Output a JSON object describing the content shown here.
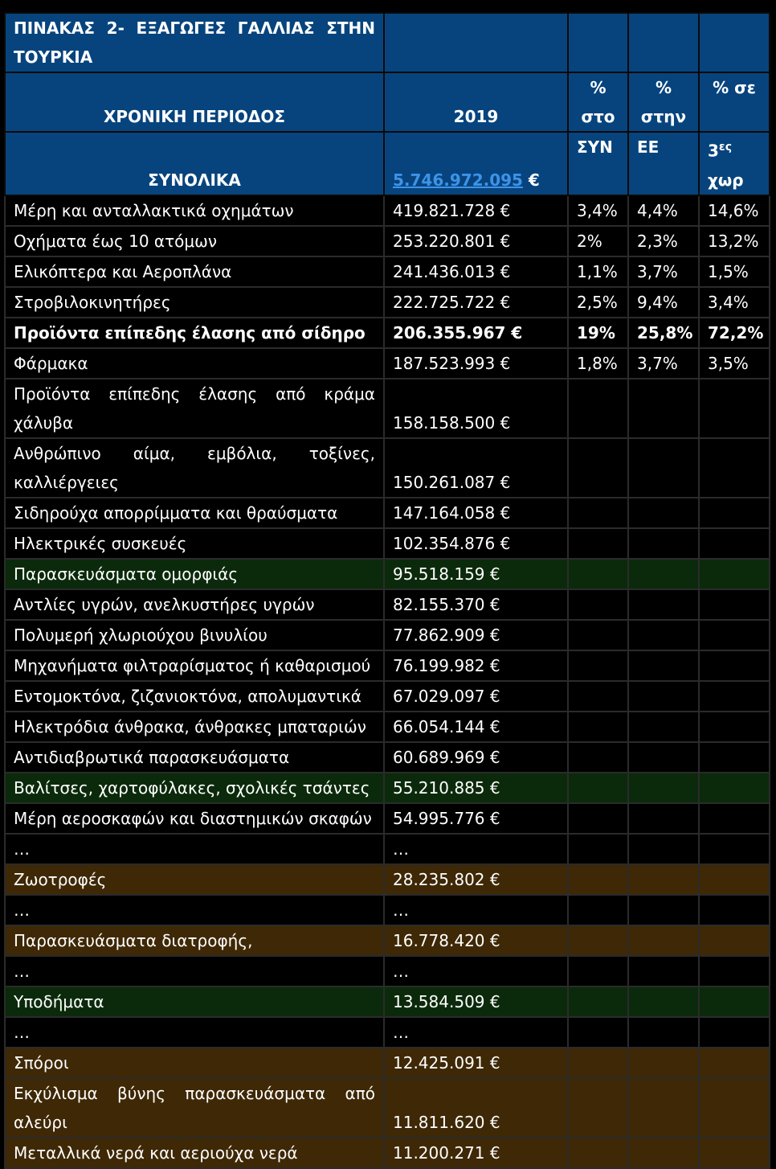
{
  "title": "ΠΙΝΑΚΑΣ 2- ΕΞΑΓΩΓΕΣ ΓΑΛΛΙΑΣ ΣΤΗΝ ΤΟΥΡΚΙΑ",
  "header": {
    "period_label": "ΧΡΟΝΙΚΗ ΠΕΡΙΟΔΟΣ",
    "year": "2019",
    "col_syn_1": "%",
    "col_syn_2": "στο",
    "col_ee_1": "%",
    "col_ee_2": "στην",
    "col_3rd": "% σε",
    "totals_label": "ΣΥΝΟΛΙΚΑ",
    "total_value": "5.746.972.095",
    "total_suffix": "€",
    "syn_cont": "ΣΥΝ",
    "ee_cont": "ΕΕ",
    "third_base": "3",
    "third_sup": "ες",
    "third_cont": "χωρ"
  },
  "rows": [
    {
      "label": "Μέρη και ανταλλακτικά οχημάτων",
      "value": "419.821.728 €",
      "syn": "3,4%",
      "ee": "4,4%",
      "third": "14,6%",
      "style": "dark"
    },
    {
      "label": "Οχήματα έως 10 ατόμων",
      "value": "253.220.801 €",
      "syn": "2%",
      "ee": "2,3%",
      "third": "13,2%",
      "style": "dark"
    },
    {
      "label": "Ελικόπτερα και Αεροπλάνα",
      "value": "241.436.013 €",
      "syn": "1,1%",
      "ee": "3,7%",
      "third": "1,5%",
      "style": "dark"
    },
    {
      "label": "Στροβιλοκινητήρες",
      "value": "222.725.722 €",
      "syn": "2,5%",
      "ee": "9,4%",
      "third": "3,4%",
      "style": "dark"
    },
    {
      "label": "Προϊόντα επίπεδης έλασης από σίδηρο",
      "value": "206.355.967 €",
      "syn": "19%",
      "ee": "25,8%",
      "third": "72,2%",
      "style": "dark bold"
    },
    {
      "label": "Φάρμακα",
      "value": "187.523.993 €",
      "syn": "1,8%",
      "ee": "3,7%",
      "third": "3,5%",
      "style": "dark"
    },
    {
      "label": "Προϊόντα επίπεδης έλασης από κράμα χάλυβα",
      "value": "158.158.500 €",
      "syn": "",
      "ee": "",
      "third": "",
      "style": "dark",
      "wrap": true
    },
    {
      "label": "Ανθρώπινο αίμα, εμβόλια, τοξίνες, καλλιέργειες",
      "value": "150.261.087 €",
      "syn": "",
      "ee": "",
      "third": "",
      "style": "dark",
      "wrap": true
    },
    {
      "label": "Σιδηρούχα απορρίμματα και θραύσματα",
      "value": "147.164.058 €",
      "syn": "",
      "ee": "",
      "third": "",
      "style": "dark"
    },
    {
      "label": "Ηλεκτρικές συσκευές",
      "value": "102.354.876 €",
      "syn": "",
      "ee": "",
      "third": "",
      "style": "dark"
    },
    {
      "label": "Παρασκευάσματα ομορφιάς",
      "value": "95.518.159 €",
      "syn": "",
      "ee": "",
      "third": "",
      "style": "green"
    },
    {
      "label": "Αντλίες υγρών, ανελκυστήρες υγρών",
      "value": "82.155.370 €",
      "syn": "",
      "ee": "",
      "third": "",
      "style": "dark"
    },
    {
      "label": "Πολυμερή χλωριούχου βινυλίου",
      "value": "77.862.909 €",
      "syn": "",
      "ee": "",
      "third": "",
      "style": "dark"
    },
    {
      "label": "Μηχανήματα φιλτραρίσματος ή καθαρισμού",
      "value": "76.199.982 €",
      "syn": "",
      "ee": "",
      "third": "",
      "style": "dark"
    },
    {
      "label": "Εντομοκτόνα, ζιζανιοκτόνα, απολυμαντικά",
      "value": "67.029.097 €",
      "syn": "",
      "ee": "",
      "third": "",
      "style": "dark"
    },
    {
      "label": "Ηλεκτρόδια άνθρακα, άνθρακες μπαταριών",
      "value": "66.054.144 €",
      "syn": "",
      "ee": "",
      "third": "",
      "style": "dark"
    },
    {
      "label": "Αντιδιαβρωτικά παρασκευάσματα",
      "value": "60.689.969 €",
      "syn": "",
      "ee": "",
      "third": "",
      "style": "dark"
    },
    {
      "label": "Βαλίτσες, χαρτοφύλακες, σχολικές τσάντες",
      "value": "55.210.885 €",
      "syn": "",
      "ee": "",
      "third": "",
      "style": "green"
    },
    {
      "label": "Μέρη αεροσκαφών και διαστημικών σκαφών",
      "value": "54.995.776 €",
      "syn": "",
      "ee": "",
      "third": "",
      "style": "dark"
    },
    {
      "label": "…",
      "value": "…",
      "syn": "",
      "ee": "",
      "third": "",
      "style": "dark"
    },
    {
      "label": "Ζωοτροφές",
      "value": "28.235.802 €",
      "syn": "",
      "ee": "",
      "third": "",
      "style": "brown"
    },
    {
      "label": "…",
      "value": "…",
      "syn": "",
      "ee": "",
      "third": "",
      "style": "dark"
    },
    {
      "label": "Παρασκευάσματα διατροφής,",
      "value": "16.778.420 €",
      "syn": "",
      "ee": "",
      "third": "",
      "style": "brown"
    },
    {
      "label": "…",
      "value": "…",
      "syn": "",
      "ee": "",
      "third": "",
      "style": "dark"
    },
    {
      "label": "Υποδήματα",
      "value": "13.584.509 €",
      "syn": "",
      "ee": "",
      "third": "",
      "style": "green"
    },
    {
      "label": "…",
      "value": "…",
      "syn": "",
      "ee": "",
      "third": "",
      "style": "dark"
    },
    {
      "label": "Σπόροι",
      "value": "12.425.091 €",
      "syn": "",
      "ee": "",
      "third": "",
      "style": "brown"
    },
    {
      "label": "Εκχύλισμα βύνης παρασκευάσματα από αλεύρι",
      "value": "11.811.620 €",
      "syn": "",
      "ee": "",
      "third": "",
      "style": "brown",
      "wrap": true
    },
    {
      "label": "Μεταλλικά νερά και αεριούχα νερά",
      "value": "11.200.271 €",
      "syn": "",
      "ee": "",
      "third": "",
      "style": "brown"
    }
  ]
}
